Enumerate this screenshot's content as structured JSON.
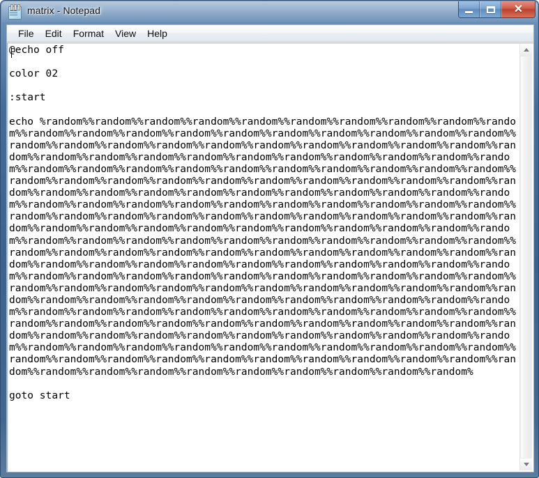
{
  "window": {
    "title": "matrix - Notepad",
    "icon": "notepad-icon",
    "controls": {
      "minimize_label": "–",
      "maximize_label": "□",
      "close_label": "✕"
    }
  },
  "menubar": {
    "items": [
      {
        "label": "File"
      },
      {
        "label": "Edit"
      },
      {
        "label": "Format"
      },
      {
        "label": "View"
      },
      {
        "label": "Help"
      }
    ]
  },
  "editor": {
    "font": "monospace",
    "word_wrap": true,
    "content": "@echo off\n\ncolor 02\n\n:start\n\necho %random%%random%%random%%random%%random%%random%%random%%random%%random%%random%%random%%random%%random%%random%%random%%random%%random%%random%%random%%random%%random%%random%%random%%random%%random%%random%%random%%random%%random%%random%%random%%random%%random%%random%%random%%random%%random%%random%%random%%random%%random%%random%%random%%random%%random%%random%%random%%random%%random%%random%%random%%random%%random%%random%%random%%random%%random%%random%%random%%random%%random%%random%%random%%random%%random%%random%%random%%random%%random%%random%%random%%random%%random%%random%%random%%random%%random%%random%%random%%random%%random%%random%%random%%random%%random%%random%%random%%random%%random%%random%%random%%random%%random%%random%%random%%random%%random%%random%%random%%random%%random%%random%%random%%random%%random%%random%%random%%random%%random%%random%%random%%random%%random%%random%%random%%random%%random%%random%%random%%random%%random%%random%%random%%random%%random%%random%%random%%random%%random%%random%%random%%random%%random%%random%%random%%random%%random%%random%%random%%random%%random%%random%%random%%random%%random%%random%%random%%random%%random%%random%%random%%random%%random%%random%%random%%random%%random%%random%%random%%random%%random%%random%%random%%random%%random%%random%%random%%random%%random%%random%%random%%random%%random%%random%%random%%random%%random%%random%%random%%random%%random%%random%%random%%random%%random%%random%%random%%random%%random%%random%%random%%random%%random%%random%%random%%random%%random%%random%%random%%random%%random%%random%%random%%random%%random%%random%%random%%random%%random%%random%%random%%random%%random%%random%%random%%random%%random%%random%%random%%random%%random%%random%%random%%random%%random%%random%\n\ngoto start"
  },
  "scrollbar": {
    "orientation": "vertical",
    "up_arrow": "scroll-up-arrow",
    "down_arrow": "scroll-down-arrow"
  }
}
